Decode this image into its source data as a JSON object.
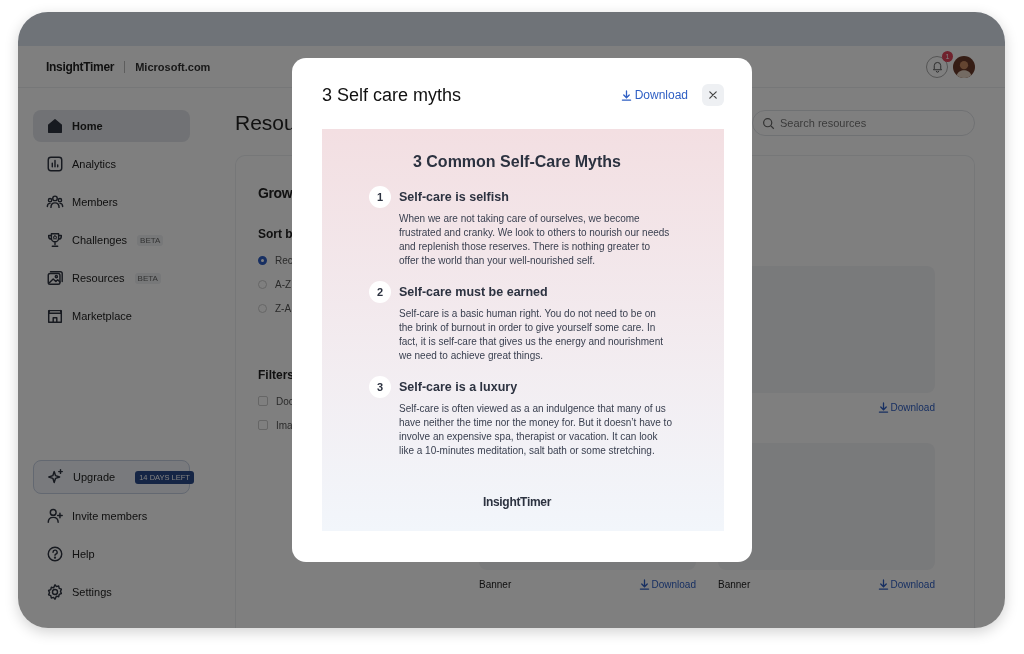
{
  "header": {
    "logo": "InsightTimer",
    "organization": "Microsoft.com",
    "notification_count": "1"
  },
  "sidebar": {
    "items": [
      {
        "label": "Home",
        "selected": true
      },
      {
        "label": "Analytics",
        "selected": false
      },
      {
        "label": "Members",
        "selected": false
      },
      {
        "label": "Challenges",
        "badge": "BETA",
        "selected": false
      },
      {
        "label": "Resources",
        "badge": "BETA",
        "selected": false
      },
      {
        "label": "Marketplace",
        "selected": false
      }
    ],
    "upgrade": {
      "label": "Upgrade",
      "badge": "14 DAYS LEFT"
    },
    "footer_items": [
      {
        "label": "Invite members"
      },
      {
        "label": "Help"
      },
      {
        "label": "Settings"
      }
    ]
  },
  "main": {
    "title": "Resou",
    "search": {
      "placeholder": "Search resources"
    },
    "panel": {
      "title": "Grow",
      "sort": {
        "heading": "Sort b",
        "options": [
          {
            "label": "Rec",
            "selected": true
          },
          {
            "label": "A-Z",
            "selected": false
          },
          {
            "label": "Z-A",
            "selected": false
          }
        ]
      },
      "filters": {
        "heading": "Filters",
        "options": [
          {
            "label": "Doc",
            "checked": false
          },
          {
            "label": "Ima",
            "checked": false
          }
        ]
      },
      "resources": [
        {
          "download": "Download"
        },
        {
          "label": "Banner",
          "download": "Download"
        },
        {
          "label": "Banner",
          "download": "Download"
        }
      ]
    }
  },
  "modal": {
    "title": "3 Self care myths",
    "download": "Download",
    "document": {
      "heading": "3 Common Self-Care Myths",
      "myths": [
        {
          "number": "1",
          "title": "Self-care is selfish",
          "body": "When we are not taking care of ourselves, we become frustrated and cranky. We look to others to nourish our needs and replenish those reserves. There is nothing greater to offer the world than your well-nourished self."
        },
        {
          "number": "2",
          "title": "Self-care must be earned",
          "body": "Self-care is a basic human right. You do not need to be on the brink of burnout in order to give yourself some care. In fact, it is self-care that gives us the energy and nourishment we need to achieve great things."
        },
        {
          "number": "3",
          "title": "Self-care is a luxury",
          "body": "Self-care is often viewed as a an indulgence that many of us have neither the time nor the money for. But it doesn’t have to involve an expensive spa, therapist or vacation. It can look like a 10-minutes meditation, salt bath or some stretching."
        }
      ],
      "logo": "InsightTimer"
    }
  }
}
